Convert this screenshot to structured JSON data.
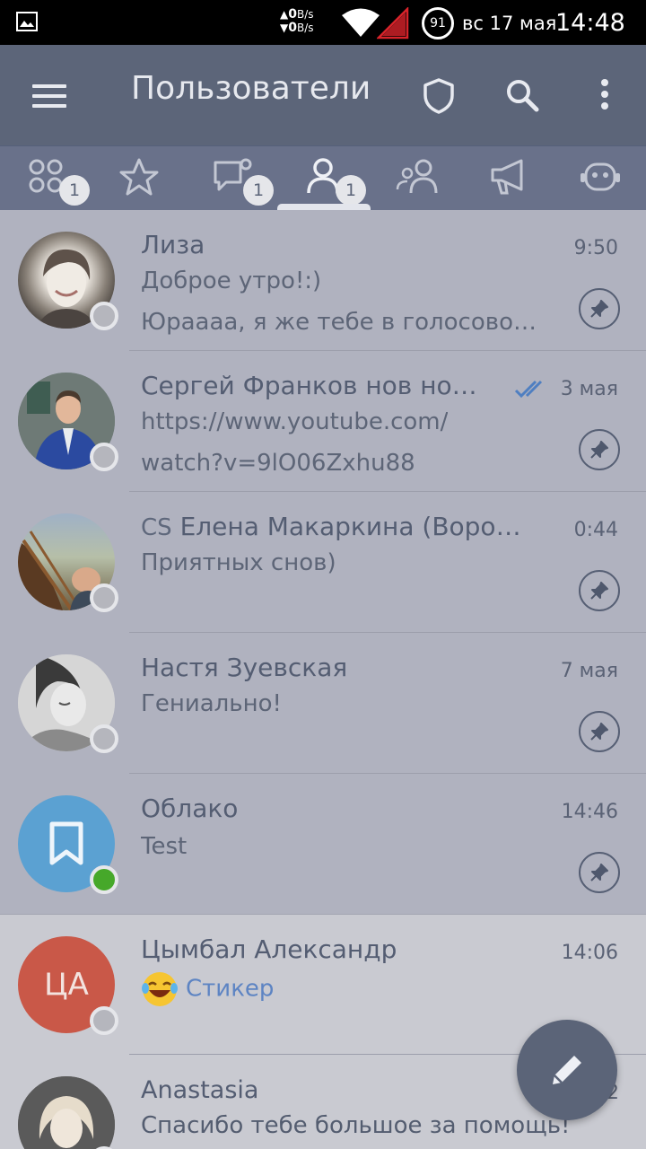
{
  "status_bar": {
    "net_up": "0",
    "net_up_unit": "B/s",
    "net_down": "0",
    "net_down_unit": "B/s",
    "battery": "91",
    "date": "вс 17 мая",
    "time": "14:48"
  },
  "toolbar": {
    "title": "Пользователи",
    "menu_icon": "hamburger-icon",
    "shield_icon": "shield-icon",
    "search_icon": "search-icon",
    "more_icon": "more-vertical-icon"
  },
  "tabs": [
    {
      "icon": "all-chats-icon",
      "badge": "1"
    },
    {
      "icon": "star-icon",
      "badge": ""
    },
    {
      "icon": "chat-unread-icon",
      "badge": "1"
    },
    {
      "icon": "user-icon",
      "badge": "1",
      "active": true
    },
    {
      "icon": "group-icon",
      "badge": ""
    },
    {
      "icon": "channel-icon",
      "badge": ""
    },
    {
      "icon": "bot-icon",
      "badge": ""
    }
  ],
  "chats": [
    {
      "name": "Лиза",
      "time": "9:50",
      "line1": "Доброе утро!:)",
      "line2": "Юраааа, я же тебе в голосовом…",
      "pinned": true,
      "online": false
    },
    {
      "name": "Сергей Франков нов но…",
      "time": "3 мая",
      "line1": "https://www.youtube.com/",
      "line2": "watch?v=9lO06Zxhu88",
      "pinned": true,
      "online": false,
      "read": true
    },
    {
      "prefix": "CS",
      "name": "Елена Макаркина (Ворон…",
      "time": "0:44",
      "line1": "Приятных снов)",
      "line2": "",
      "pinned": true,
      "online": false
    },
    {
      "name": "Настя Зуевская",
      "time": "7 мая",
      "line1": "Гениально!",
      "line2": "",
      "pinned": true,
      "online": false
    },
    {
      "name": "Облако",
      "time": "14:46",
      "line1": "Test",
      "line2": "",
      "pinned": true,
      "online": true
    },
    {
      "name": "Цымбал Александр",
      "initials": "ЦА",
      "time": "14:06",
      "line1": "Стикер",
      "line2": "",
      "pinned": false,
      "online": false
    },
    {
      "name": "Anastasia",
      "time": "2",
      "line1": "Спасибо тебе большое за помощь!",
      "line2": "",
      "pinned": false,
      "online": false
    }
  ],
  "colors": {
    "toolbar": "#5c6579",
    "pinned_bg": "#b0b2bf",
    "normal_bg": "#c9cad1",
    "cloud_avatar": "#5ba1d2",
    "initials_avatar": "#c95848",
    "online": "#46a82a"
  },
  "fab": {
    "icon": "pencil-icon"
  }
}
